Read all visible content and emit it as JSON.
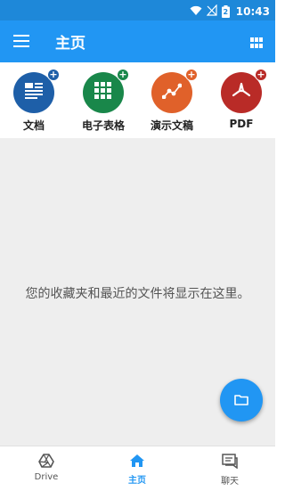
{
  "status_bar": {
    "time": "10:43",
    "battery_level": "2",
    "icons": [
      "wifi-icon",
      "no-signal-icon",
      "battery-icon"
    ]
  },
  "app_bar": {
    "title": "主页",
    "menu_icon": "menu-icon",
    "grid_icon": "grid-view-icon"
  },
  "quick_create": [
    {
      "label": "文档",
      "icon": "document-icon",
      "color": "#1e5fa8"
    },
    {
      "label": "电子表格",
      "icon": "spreadsheet-icon",
      "color": "#19874a"
    },
    {
      "label": "演示文稿",
      "icon": "presentation-icon",
      "color": "#e0612a"
    },
    {
      "label": "PDF",
      "icon": "pdf-icon",
      "color": "#b92b27"
    }
  ],
  "empty_state": {
    "message": "您的收藏夹和最近的文件将显示在这里。"
  },
  "fab": {
    "icon": "folder-icon"
  },
  "bottom_nav": [
    {
      "label": "Drive",
      "icon": "drive-icon",
      "active": false
    },
    {
      "label": "主页",
      "icon": "home-icon",
      "active": true
    },
    {
      "label": "聊天",
      "icon": "chat-icon",
      "active": false
    }
  ],
  "colors": {
    "accent": "#2196f3",
    "status_bar": "#1e88d9",
    "content_background": "#eeeeee",
    "inactive_nav": "#555555"
  }
}
